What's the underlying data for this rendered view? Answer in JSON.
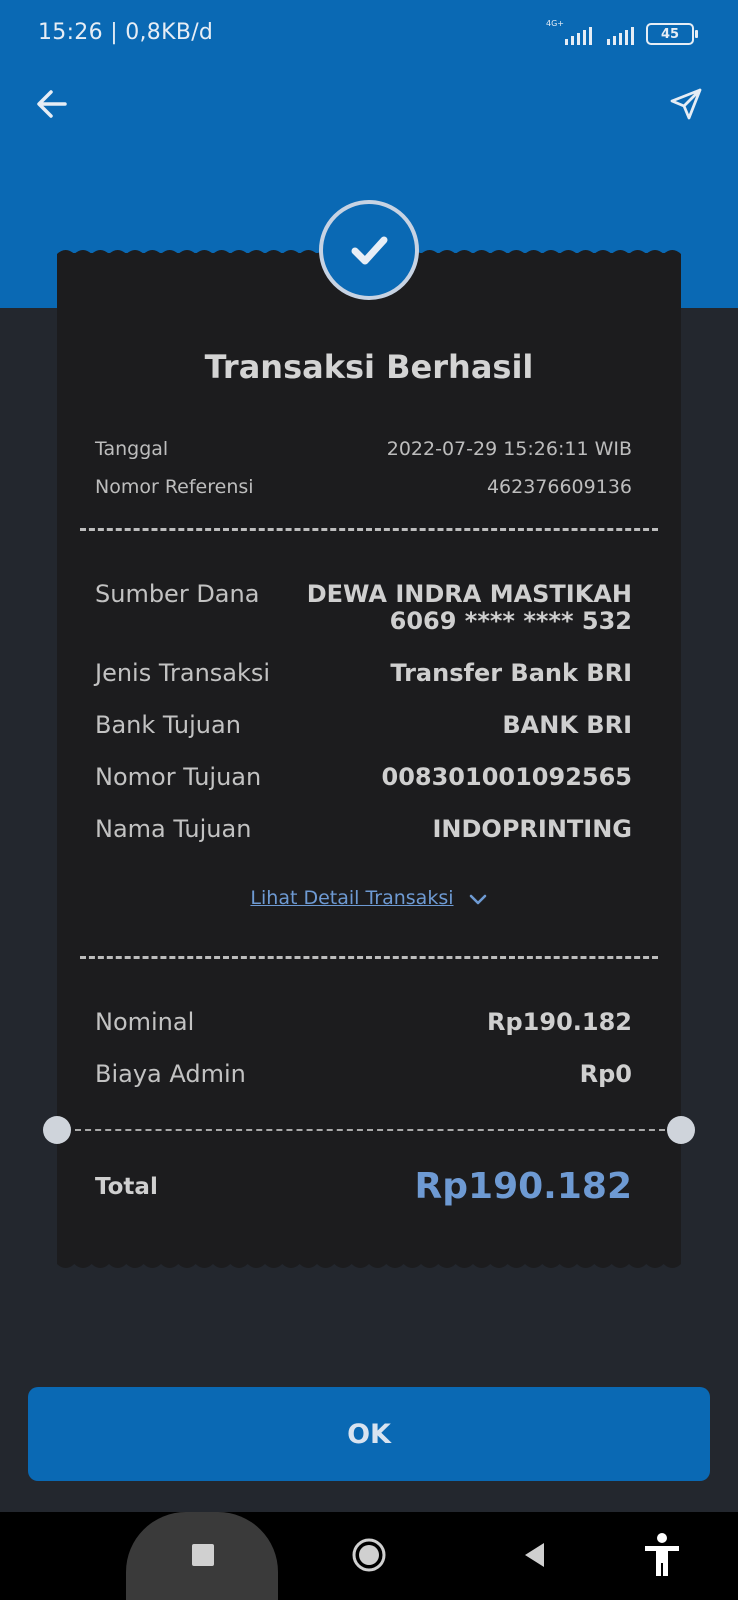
{
  "status_bar": {
    "time": "15:26 | 0,8KB/d",
    "network": "4G+",
    "battery": "45"
  },
  "header": {
    "back_icon": "arrow-left-icon",
    "share_icon": "send-icon"
  },
  "receipt": {
    "title": "Transaksi Berhasil",
    "meta": [
      {
        "label": "Tanggal",
        "value": "2022-07-29 15:26:11 WIB"
      },
      {
        "label": "Nomor Referensi",
        "value": "462376609136"
      }
    ],
    "details": {
      "sumber_dana_label": "Sumber Dana",
      "sumber_dana_name": "DEWA INDRA MASTIKAH",
      "sumber_dana_account": "6069 **** **** 532",
      "jenis_label": "Jenis Transaksi",
      "jenis_value": "Transfer Bank BRI",
      "bank_label": "Bank Tujuan",
      "bank_value": "BANK BRI",
      "nomor_label": "Nomor Tujuan",
      "nomor_value": "008301001092565",
      "nama_label": "Nama Tujuan",
      "nama_value": "INDOPRINTING"
    },
    "detail_link": "Lihat Detail Transaksi",
    "amounts": {
      "nominal_label": "Nominal",
      "nominal_value": "Rp190.182",
      "admin_label": "Biaya Admin",
      "admin_value": "Rp0"
    },
    "total_label": "Total",
    "total_value": "Rp190.182"
  },
  "ok_button": "OK",
  "colors": {
    "primary": "#0a69b4",
    "link": "#6e9ad3",
    "card": "#1c1c1e",
    "background": "#23272e"
  }
}
